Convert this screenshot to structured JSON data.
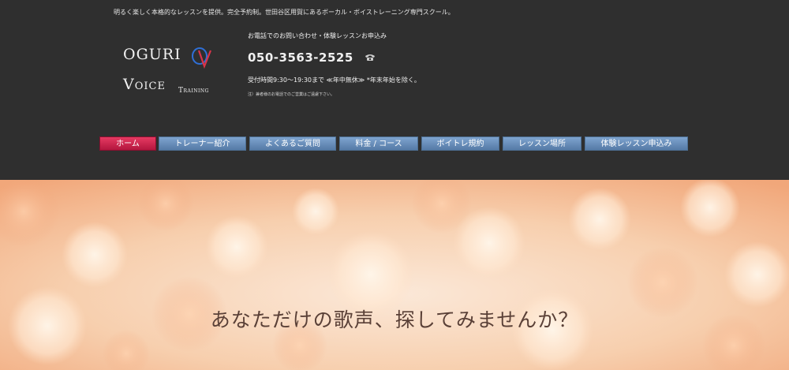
{
  "header": {
    "tagline": "明るく楽しく本格的なレッスンを提供。完全予約制。世田谷区用賀にあるボーカル・ボイストレーニング専門スクール。",
    "logo": {
      "word1": "Oguri",
      "word2": "Voice",
      "word3": "Training",
      "mark": "OV",
      "colors": {
        "o": "#2f6fd6",
        "v": "#d8344a"
      }
    }
  },
  "contact": {
    "heading": "お電話でのお問い合わせ・体験レッスンお申込み",
    "phone": "050-3563-2525",
    "phone_icon": "phone-icon",
    "hours": "受付時間9:30～19:30まで ≪年中無休≫ *年末年始を除く。",
    "note": "注）兼者様のお電話でのご営業はご遠慮下さい。"
  },
  "nav": {
    "items": [
      {
        "label": "ホーム",
        "active": true
      },
      {
        "label": "トレーナー紹介",
        "active": false
      },
      {
        "label": "よくあるご質問",
        "active": false
      },
      {
        "label": "料金 / コース",
        "active": false
      },
      {
        "label": "ボイトレ規約",
        "active": false
      },
      {
        "label": "レッスン場所",
        "active": false
      },
      {
        "label": "体験レッスン申込み",
        "active": false
      }
    ],
    "colors": {
      "active": "#c8244c",
      "default": "#6a8fbb"
    }
  },
  "hero": {
    "headline": "あなただけの歌声、探してみませんか？",
    "background": "bokeh-orange"
  }
}
